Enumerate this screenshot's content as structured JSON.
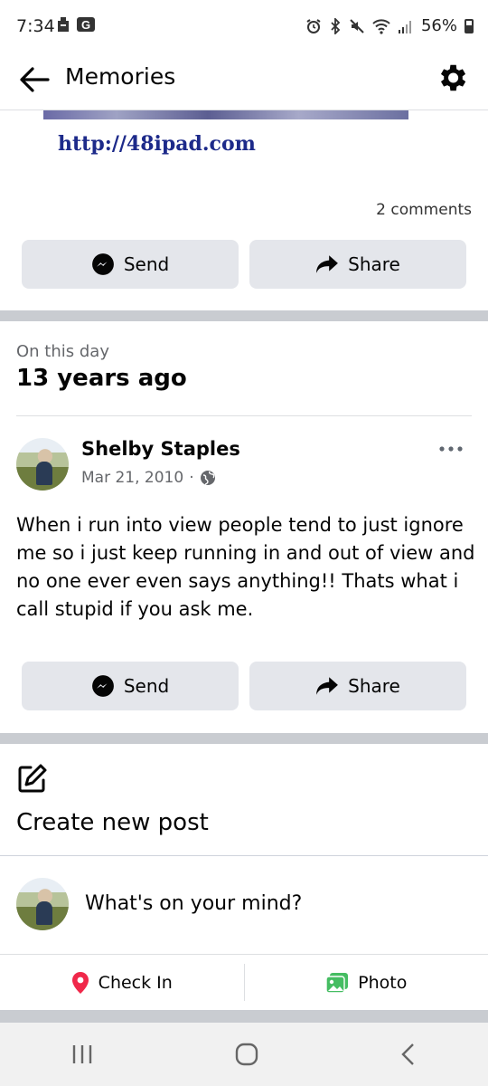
{
  "status_bar": {
    "time": "7:34",
    "left_icons": [
      "phone-battery-icon",
      "g-app-icon"
    ],
    "right_icons": [
      "alarm-icon",
      "bluetooth-icon",
      "mute-icon",
      "wifi-icon",
      "signal-icon"
    ],
    "battery": "56%"
  },
  "header": {
    "title": "Memories",
    "back_icon": "back-arrow-icon",
    "settings_icon": "gear-icon"
  },
  "previous_post": {
    "link_text": "http://48ipad.com",
    "comments": "2 comments",
    "send_label": "Send",
    "share_label": "Share"
  },
  "memory": {
    "subheading": "On this day",
    "title": "13 years ago",
    "post": {
      "author": "Shelby Staples",
      "date": "Mar 21, 2010",
      "date_separator": "·",
      "privacy_icon": "globe-icon",
      "text": "When i run into view people tend to just ignore me so i just keep running in and out of view and no one ever even says anything!! Thats what i call stupid if you ask me.",
      "send_label": "Send",
      "share_label": "Share"
    }
  },
  "create_post": {
    "label": "Create new post",
    "placeholder": "What's on your mind?",
    "check_in_label": "Check In",
    "photo_label": "Photo"
  },
  "colors": {
    "button_bg": "#e4e6eb",
    "divider": "#c9ccd1",
    "muted_text": "#65676b",
    "link_blue": "#1d2a8a",
    "check_in_red": "#f0284a",
    "photo_green": "#45bd62"
  }
}
